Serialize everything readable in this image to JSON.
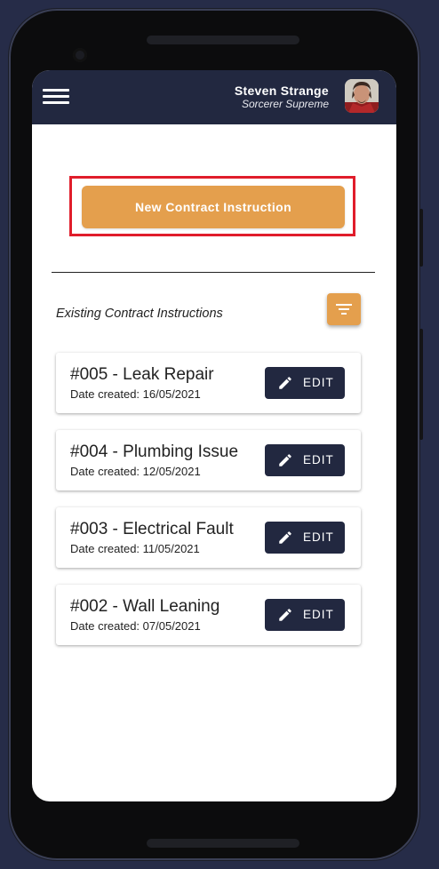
{
  "user": {
    "name": "Steven Strange",
    "role": "Sorcerer Supreme"
  },
  "actions": {
    "new_contract_label": "New Contract Instruction"
  },
  "section": {
    "title": "Existing Contract Instructions"
  },
  "contracts": [
    {
      "title": "#005 - Leak Repair",
      "date_label": "Date created: 16/05/2021",
      "edit_label": "EDIT"
    },
    {
      "title": "#004 - Plumbing Issue",
      "date_label": "Date created: 12/05/2021",
      "edit_label": "EDIT"
    },
    {
      "title": "#003 - Electrical Fault",
      "date_label": "Date created: 11/05/2021",
      "edit_label": "EDIT"
    },
    {
      "title": "#002 - Wall Leaning",
      "date_label": "Date created: 07/05/2021",
      "edit_label": "EDIT"
    }
  ],
  "icons": {
    "menu": "hamburger-menu-icon",
    "filter": "filter-icon",
    "edit": "pencil-icon"
  },
  "colors": {
    "appbar": "#222840",
    "accent": "#e49f4d",
    "highlight": "#e01d2b",
    "edit_button": "#222840"
  }
}
